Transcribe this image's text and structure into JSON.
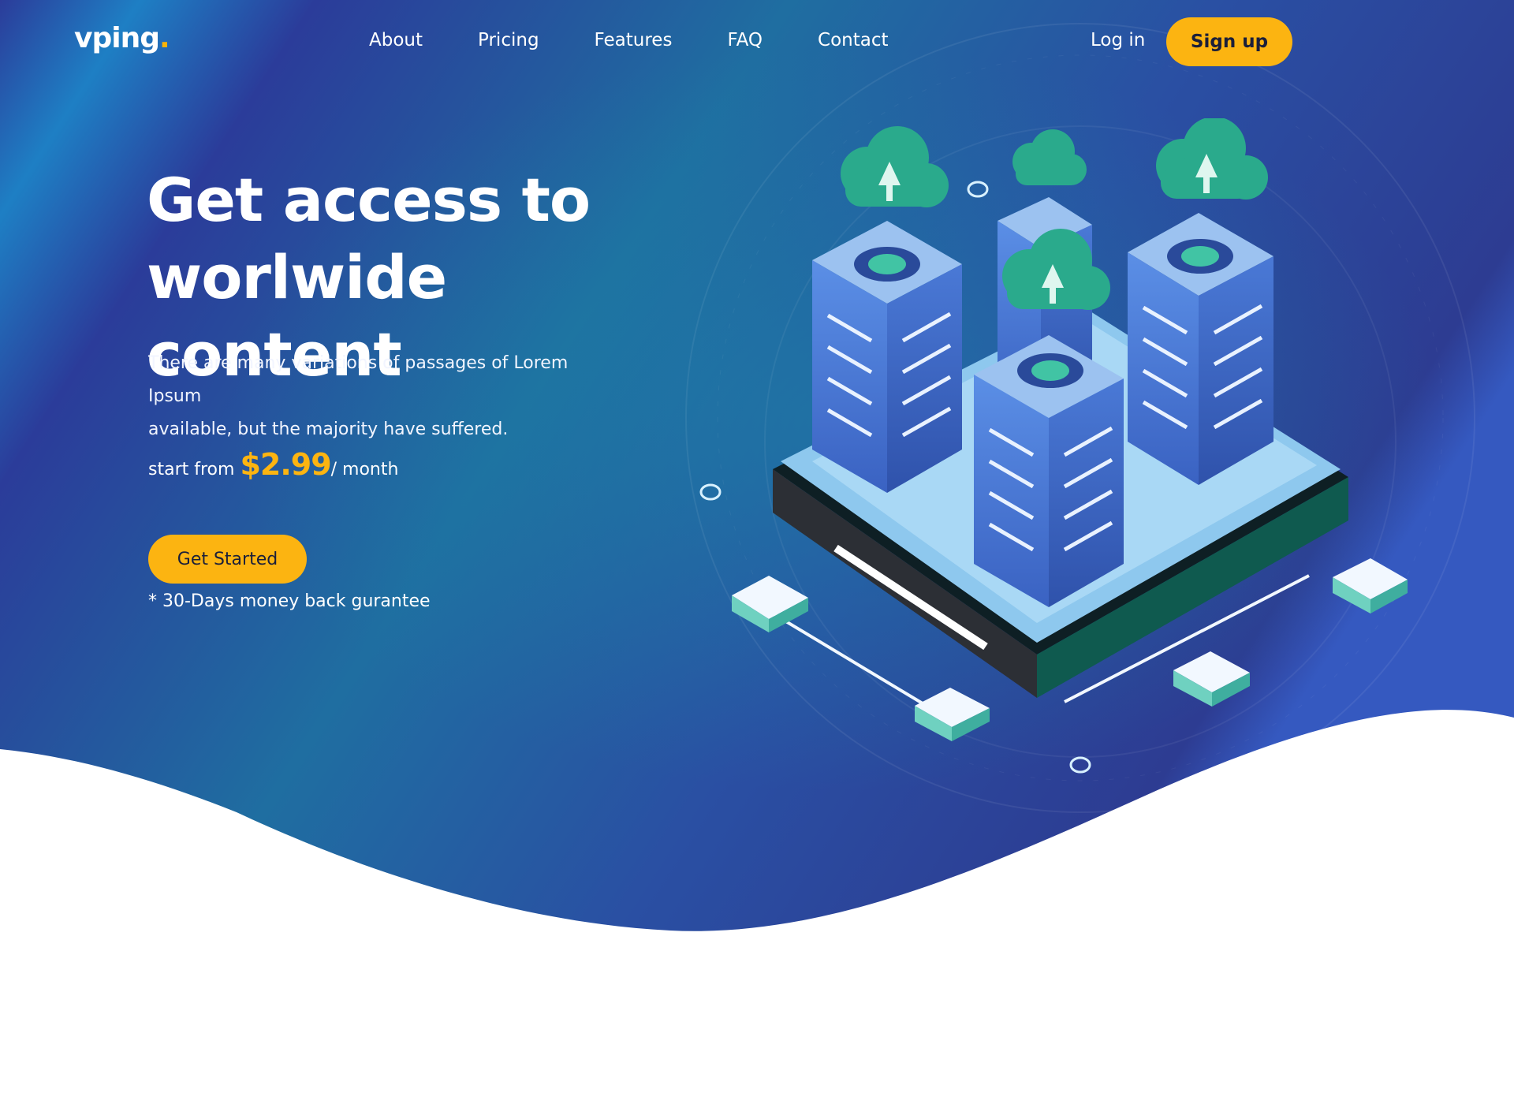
{
  "brand": {
    "name": "vping",
    "dot": "."
  },
  "nav": {
    "links": [
      "About",
      "Pricing",
      "Features",
      "FAQ",
      "Contact"
    ],
    "login_label": "Log in",
    "signup_label": "Sign up"
  },
  "hero": {
    "headline_line1": "Get access to",
    "headline_line2": "worlwide content",
    "subtext_line1": "There are many variations of passages of Lorem Ipsum",
    "subtext_line2": "available, but the majority have suffered.",
    "price_prefix": "start from",
    "price_amount": "$2.99",
    "price_suffix": "/ month",
    "cta_label": "Get Started",
    "guarantee": "* 30-Days money back gurantee"
  },
  "colors": {
    "accent": "#fcb411",
    "bg_dark": "#2a3f97",
    "bg_teal": "#1d6f9e",
    "server_blue": "#3e6fcf",
    "cloud_teal": "#2aaa8c"
  },
  "icons": [
    "cloud-upload-icon",
    "server-rack-icon",
    "network-node-icon"
  ]
}
